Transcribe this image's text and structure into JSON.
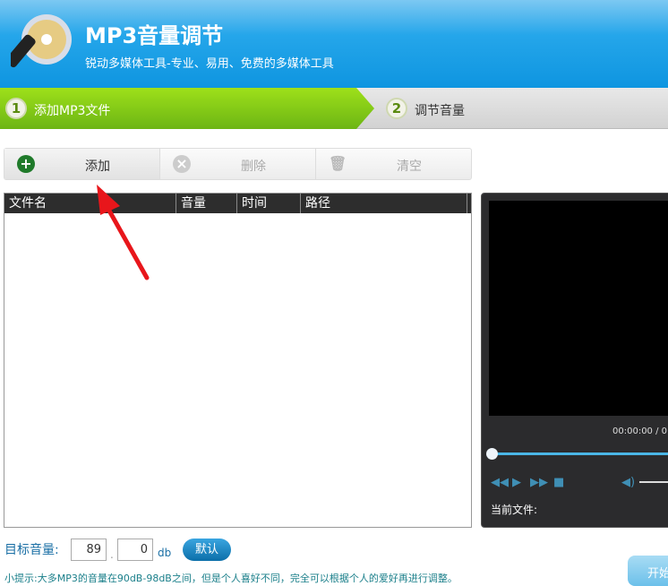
{
  "header": {
    "title": "MP3音量调节",
    "subtitle": "锐动多媒体工具-专业、易用、免费的多媒体工具"
  },
  "steps": [
    {
      "num": "1",
      "label": "添加MP3文件",
      "active": true
    },
    {
      "num": "2",
      "label": "调节音量",
      "active": false
    }
  ],
  "toolbar": {
    "add": "添加",
    "delete": "删除",
    "clear": "清空"
  },
  "table": {
    "columns": [
      "文件名",
      "音量",
      "时间",
      "路径"
    ],
    "rows": []
  },
  "player": {
    "time": "00:00:00 / 0",
    "current_file_label": "当前文件:"
  },
  "volume": {
    "label": "目标音量:",
    "integer": "89",
    "decimal": "0",
    "unit": "db",
    "default_button": "默认"
  },
  "tip": "小提示:大多MP3的音量在90dB-98dB之间，但是个人喜好不同，完全可以根据个人的爱好再进行调整。",
  "start_button": "开始",
  "colors": {
    "header": "#1a9ee6",
    "active_step": "#7cc417",
    "arrow": "#e8161b"
  }
}
